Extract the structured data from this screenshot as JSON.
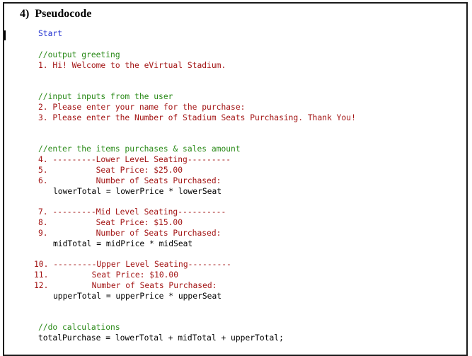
{
  "document": {
    "heading": "4)  Pseudocode",
    "lines": [
      {
        "text": "Start",
        "kind": "keyword"
      },
      {
        "text": "//output greeting",
        "kind": "comment"
      },
      {
        "text": "1. Hi! Welcome to the eVirtual Stadium.",
        "kind": "string"
      },
      {
        "text": "//input inputs from the user",
        "kind": "comment"
      },
      {
        "text": "2. Please enter your name for the purchase:",
        "kind": "string"
      },
      {
        "text": "3. Please enter the Number of Stadium Seats Purchasing. Thank You!",
        "kind": "string"
      },
      {
        "text": "//enter the items purchases & sales amount",
        "kind": "comment"
      },
      {
        "text": "4. ---------Lower LeveL Seating---------",
        "kind": "string"
      },
      {
        "text": "5.          Seat Price: $25.00",
        "kind": "string"
      },
      {
        "text": "6.          Number of Seats Purchased:",
        "kind": "string"
      },
      {
        "text": "lowerTotal = lowerPrice * lowerSeat",
        "kind": "plain"
      },
      {
        "text": "7. ---------Mid Level Seating----------",
        "kind": "string"
      },
      {
        "text": "8.          Seat Price: $15.00",
        "kind": "string"
      },
      {
        "text": "9.          Number of Seats Purchased:",
        "kind": "string"
      },
      {
        "text": "midTotal = midPrice * midSeat",
        "kind": "plain"
      },
      {
        "text": "10. ---------Upper Level Seating---------",
        "kind": "string"
      },
      {
        "text": "11.         Seat Price: $10.00",
        "kind": "string"
      },
      {
        "text": "12.         Number of Seats Purchased:",
        "kind": "string"
      },
      {
        "text": "upperTotal = upperPrice * upperSeat",
        "kind": "plain"
      },
      {
        "text": "//do calculations",
        "kind": "comment"
      },
      {
        "text": "totalPurchase = lowerTotal + midTotal + upperTotal;",
        "kind": "plain"
      }
    ]
  },
  "colors": {
    "keyword": "#1f2fd0",
    "comment": "#2a8a18",
    "string": "#a31515",
    "plain": "#000000",
    "border": "#1a1a1a"
  }
}
